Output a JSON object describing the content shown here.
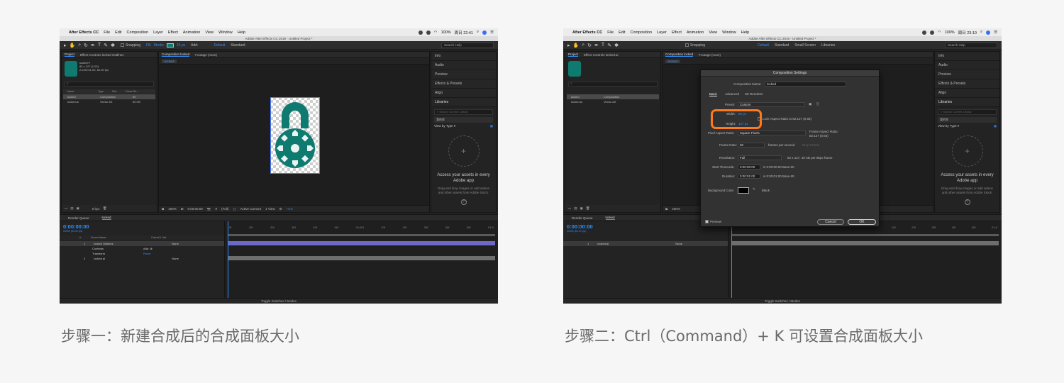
{
  "left": {
    "menubar": {
      "app": "After Effects CC",
      "items": [
        "File",
        "Edit",
        "Composition",
        "Layer",
        "Effect",
        "Animation",
        "View",
        "Window",
        "Help"
      ],
      "status": "100%",
      "clock": "周日 22:41"
    },
    "window_title": "Adobe After Effects CC 2018 - Untitled Project *",
    "toolbar": {
      "snapping": "Snapping",
      "fill": "Fill",
      "stroke": "Stroke",
      "stroke_px": "24 px",
      "add": "Add:",
      "workspace_default": "Default",
      "workspace_standard": "Standard",
      "search": "Search Help"
    },
    "project": {
      "tab": "Project",
      "effect_tab": "Effect Controls locked Outlines",
      "item_name": "locked ▾",
      "item_size": "82 x 127 (1.00)",
      "item_dur": "Δ 0:00:01:00, 60.00 fps",
      "search": "⌕",
      "columns": [
        "Name",
        "Type",
        "Size",
        "Frame Ra..."
      ],
      "rows": [
        {
          "name": "locked",
          "type": "Composition",
          "size": "",
          "fps": "60"
        },
        {
          "name": "locked.ai",
          "type": "Vector Art",
          "size": "60 KB",
          "fps": ""
        }
      ],
      "bpc": "8 bpc"
    },
    "comp": {
      "tab": "Composition locked",
      "footage_tab": "Footage (none)",
      "crumb": "locked",
      "zoom": "400%",
      "time": "0:00:00:00",
      "quality": "(Full)",
      "camera": "Active Camera",
      "view": "1 View",
      "offset": "+0.0"
    },
    "right_panels": [
      "Info",
      "Audio",
      "Preview",
      "Effects & Presets",
      "Align"
    ],
    "libraries": {
      "title": "Libraries",
      "search": "⌕ Search Current Library",
      "library": "我的库",
      "view_by": "View by Type ▾",
      "access": "Access your assets in every Adobe app",
      "drag": "Drag and drop images or add videos and other assets from Adobe Stock."
    },
    "timeline": {
      "render_queue": "Render Queue",
      "comp_tab": "locked",
      "timecode": "0:00:00:00",
      "tc_sub": "00000 (60.00 fps)",
      "columns": [
        "#",
        "Source Name",
        "Parent & Link"
      ],
      "layers": [
        {
          "num": "1",
          "name": "locked Outlines",
          "parent": "None"
        },
        {
          "num": "",
          "name": "Contents",
          "parent": "Add: ⊕"
        },
        {
          "num": "",
          "name": "Transform",
          "parent": "Reset"
        },
        {
          "num": "2",
          "name": "locked.ai",
          "parent": "None"
        }
      ],
      "ruler": [
        "0f",
        "10f",
        "20f",
        "30f",
        "40f",
        "50f",
        "01:00f",
        "10f",
        "20f",
        "30f",
        "40f",
        "50f",
        "01:0"
      ],
      "toggle": "Toggle Switches / Modes"
    },
    "caption": "步骤一：新建合成后的合成面板大小"
  },
  "right": {
    "menubar": {
      "app": "After Effects CC",
      "items": [
        "File",
        "Edit",
        "Composition",
        "Layer",
        "Effect",
        "Animation",
        "View",
        "Window",
        "Help"
      ],
      "status": "100%",
      "clock": "周日 23:10"
    },
    "window_title": "Adobe After Effects CC 2018 - Untitled Project *",
    "toolbar": {
      "snapping": "Snapping",
      "workspace_default": "Default",
      "workspace_standard": "Standard",
      "workspace_small": "Small Screen",
      "workspace_libraries": "Libraries",
      "search": "Search Help"
    },
    "project": {
      "tab": "Project",
      "effect_tab": "Effect Controls locked.ai",
      "rows": [
        {
          "name": "locked",
          "type": "Composition"
        },
        {
          "name": "locked.ai",
          "type": "Vector Art"
        }
      ]
    },
    "comp": {
      "tab": "Composition locked",
      "footage_tab": "Footage (none)",
      "crumb": "locked",
      "zoom": "400%",
      "offset": "+0.0"
    },
    "dialog": {
      "title": "Composition Settings",
      "name_label": "Composition Name:",
      "name_value": "locked",
      "tabs": [
        "Basic",
        "Advanced",
        "3D Renderer"
      ],
      "preset_label": "Preset:",
      "preset_value": "Custom",
      "width_label": "Width:",
      "width_value": "82 px",
      "height_label": "Height:",
      "height_value": "127 px",
      "lock_aspect": "Lock Aspect Ratio to 82:127 (0.65)",
      "par_label": "Pixel Aspect Ratio:",
      "par_value": "Square Pixels",
      "frame_aspect_label": "Frame Aspect Ratio:",
      "frame_aspect_value": "82:127 (0.65)",
      "fps_label": "Frame Rate:",
      "fps_value": "60",
      "fps_unit": "frames per second",
      "drop_frame": "Drop Frame",
      "res_label": "Resolution:",
      "res_value": "Full",
      "res_info": "82 x 127, 40 KB per 8bpc frame",
      "start_label": "Start Timecode:",
      "start_value": "0:00:00:00",
      "start_info": "is 0:00:00:00  Base 60",
      "dur_label": "Duration:",
      "dur_value": "0:00:01:00",
      "dur_info": "is 0:00:01:00  Base 60",
      "bg_label": "Background Color:",
      "bg_value": "Black",
      "preview": "Preview",
      "cancel": "Cancel",
      "ok": "OK"
    },
    "right_panels": [
      "Info",
      "Audio",
      "Preview",
      "Effects & Presets",
      "Align"
    ],
    "libraries": {
      "title": "Libraries",
      "search": "⌕ Search Current Library",
      "library": "我的库",
      "view_by": "View by Type ▾",
      "access": "Access your assets in every Adobe app",
      "drag": "Drag and drop images or add videos and other assets from Adobe Stock."
    },
    "timeline": {
      "render_queue": "Render Queue",
      "comp_tab": "locked",
      "timecode": "0:00:00:00",
      "tc_sub": "00000 (60.00 fps)",
      "layers": [
        {
          "num": "1",
          "name": "locked.ai",
          "parent": "None"
        }
      ],
      "ruler": [
        "10f",
        "20f",
        "30f",
        "40f",
        "50f",
        "01:0"
      ],
      "toggle": "Toggle Switches / Modes"
    },
    "caption": "步骤二：Ctrl（Command）+ K 可设置合成面板大小"
  },
  "colors": {
    "accent_blue": "#2f8fff",
    "lock_teal": "#0f7a70",
    "highlight_orange": "#ff7a1a"
  }
}
